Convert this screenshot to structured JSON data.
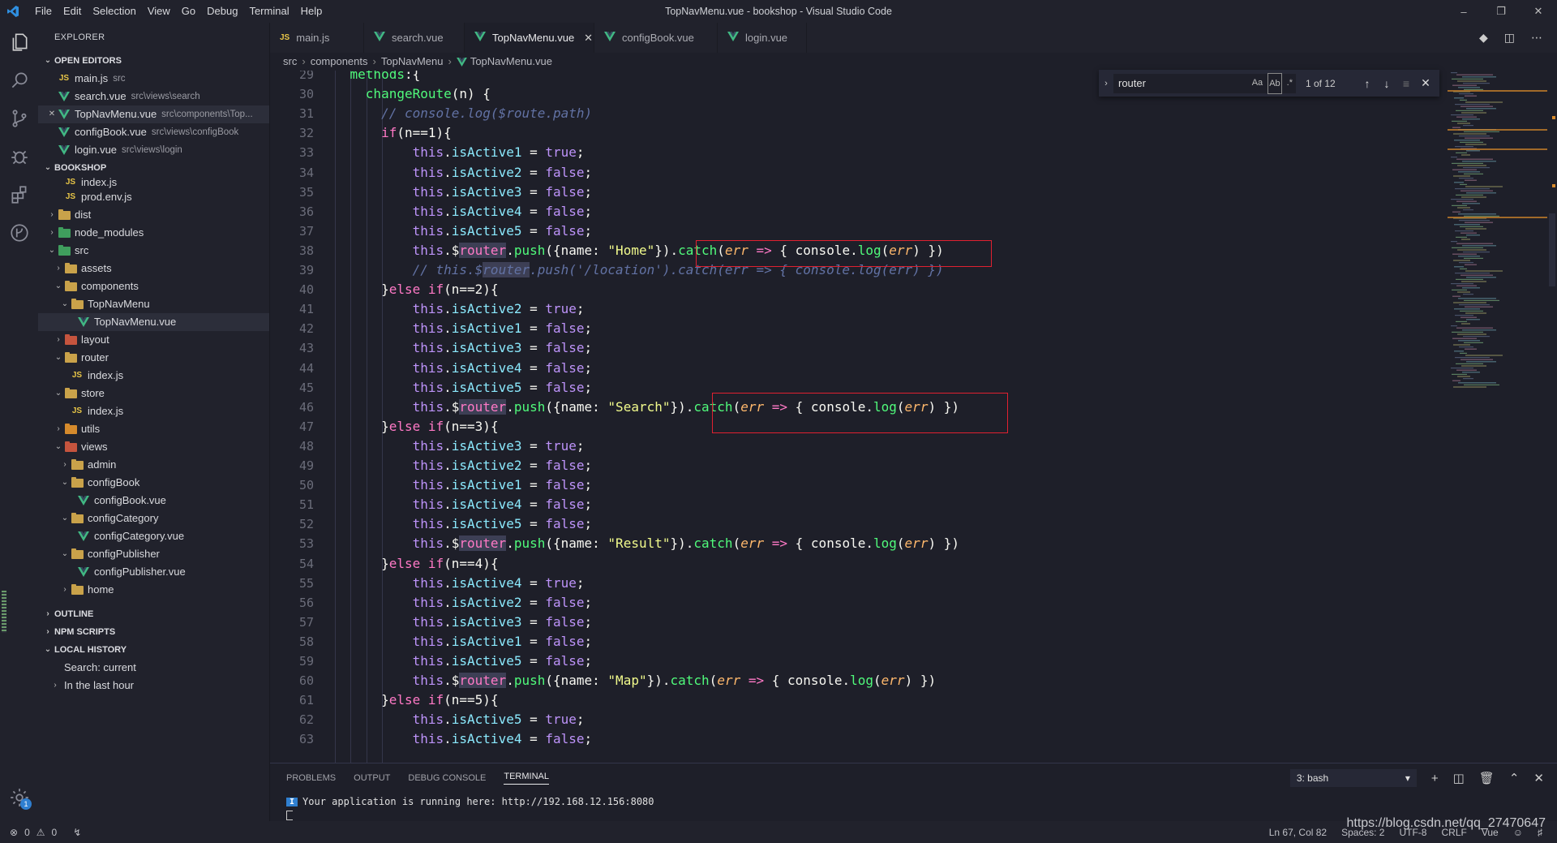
{
  "window": {
    "title": "TopNavMenu.vue - bookshop - Visual Studio Code",
    "menu": [
      "File",
      "Edit",
      "Selection",
      "View",
      "Go",
      "Debug",
      "Terminal",
      "Help"
    ]
  },
  "sidebar": {
    "title": "EXPLORER",
    "open_editors_label": "OPEN EDITORS",
    "open_editors": [
      {
        "name": "main.js",
        "desc": "src",
        "icon": "js-icon"
      },
      {
        "name": "search.vue",
        "desc": "src\\views\\search",
        "icon": "vue-icon"
      },
      {
        "name": "TopNavMenu.vue",
        "desc": "src\\components\\Top...",
        "icon": "vue-icon"
      },
      {
        "name": "configBook.vue",
        "desc": "src\\views\\configBook",
        "icon": "vue-icon"
      },
      {
        "name": "login.vue",
        "desc": "src\\views\\login",
        "icon": "vue-icon"
      }
    ],
    "project_label": "BOOKSHOP",
    "tree": [
      {
        "name": "index.js",
        "indent": 2,
        "type": "js"
      },
      {
        "name": "prod.env.js",
        "indent": 2,
        "type": "js"
      },
      {
        "name": "dist",
        "indent": 1,
        "type": "folder",
        "color": "yellow",
        "open": false
      },
      {
        "name": "node_modules",
        "indent": 1,
        "type": "folder",
        "color": "green",
        "open": false
      },
      {
        "name": "src",
        "indent": 1,
        "type": "folder",
        "color": "green",
        "open": true
      },
      {
        "name": "assets",
        "indent": 2,
        "type": "folder",
        "color": "yellow",
        "open": false
      },
      {
        "name": "components",
        "indent": 2,
        "type": "folder",
        "color": "yellow",
        "open": true
      },
      {
        "name": "TopNavMenu",
        "indent": 3,
        "type": "folder",
        "color": "yellow",
        "open": true
      },
      {
        "name": "TopNavMenu.vue",
        "indent": 4,
        "type": "vue",
        "selected": true
      },
      {
        "name": "layout",
        "indent": 2,
        "type": "folder",
        "color": "red",
        "open": false
      },
      {
        "name": "router",
        "indent": 2,
        "type": "folder",
        "color": "yellow",
        "open": true
      },
      {
        "name": "index.js",
        "indent": 3,
        "type": "js"
      },
      {
        "name": "store",
        "indent": 2,
        "type": "folder",
        "color": "yellow",
        "open": true
      },
      {
        "name": "index.js",
        "indent": 3,
        "type": "js"
      },
      {
        "name": "utils",
        "indent": 2,
        "type": "folder",
        "color": "orange",
        "open": false
      },
      {
        "name": "views",
        "indent": 2,
        "type": "folder",
        "color": "red",
        "open": true
      },
      {
        "name": "admin",
        "indent": 3,
        "type": "folder",
        "color": "yellow",
        "open": false
      },
      {
        "name": "configBook",
        "indent": 3,
        "type": "folder",
        "color": "yellow",
        "open": true
      },
      {
        "name": "configBook.vue",
        "indent": 4,
        "type": "vue"
      },
      {
        "name": "configCategory",
        "indent": 3,
        "type": "folder",
        "color": "yellow",
        "open": true
      },
      {
        "name": "configCategory.vue",
        "indent": 4,
        "type": "vue"
      },
      {
        "name": "configPublisher",
        "indent": 3,
        "type": "folder",
        "color": "yellow",
        "open": true
      },
      {
        "name": "configPublisher.vue",
        "indent": 4,
        "type": "vue"
      },
      {
        "name": "home",
        "indent": 3,
        "type": "folder",
        "color": "yellow",
        "open": false
      }
    ],
    "outline_label": "OUTLINE",
    "npm_label": "NPM SCRIPTS",
    "history_label": "LOCAL HISTORY",
    "history_items": [
      "Search: current",
      "In the last hour"
    ]
  },
  "tabs": [
    {
      "label": "main.js",
      "icon": "js-icon",
      "active": false
    },
    {
      "label": "search.vue",
      "icon": "vue-icon",
      "active": false
    },
    {
      "label": "TopNavMenu.vue",
      "icon": "vue-icon",
      "active": true
    },
    {
      "label": "configBook.vue",
      "icon": "vue-icon",
      "active": false
    },
    {
      "label": "login.vue",
      "icon": "vue-icon",
      "active": false
    }
  ],
  "breadcrumb": [
    "src",
    "components",
    "TopNavMenu",
    "TopNavMenu.vue"
  ],
  "find": {
    "value": "router",
    "count": "1 of 12"
  },
  "editor": {
    "lines": [
      {
        "n": "29",
        "t": "    methods:{"
      },
      {
        "n": "30",
        "t": "      changeRoute(n) {"
      },
      {
        "n": "31",
        "t": "        // console.log($route.path)"
      },
      {
        "n": "32",
        "t": "        if(n==1){"
      },
      {
        "n": "33",
        "t": "            this.isActive1 = true;"
      },
      {
        "n": "34",
        "t": "            this.isActive2 = false;"
      },
      {
        "n": "35",
        "t": "            this.isActive3 = false;"
      },
      {
        "n": "36",
        "t": "            this.isActive4 = false;"
      },
      {
        "n": "37",
        "t": "            this.isActive5 = false;"
      },
      {
        "n": "38",
        "t": "            this.$router.push({name: \"Home\"}).catch(err => { console.log(err) })"
      },
      {
        "n": "39",
        "t": "            // this.$router.push('/location').catch(err => { console.log(err) })"
      },
      {
        "n": "40",
        "t": "        }else if(n==2){"
      },
      {
        "n": "41",
        "t": "            this.isActive2 = true;"
      },
      {
        "n": "42",
        "t": "            this.isActive1 = false;"
      },
      {
        "n": "43",
        "t": "            this.isActive3 = false;"
      },
      {
        "n": "44",
        "t": "            this.isActive4 = false;"
      },
      {
        "n": "45",
        "t": "            this.isActive5 = false;"
      },
      {
        "n": "46",
        "t": "            this.$router.push({name: \"Search\"}).catch(err => { console.log(err) })"
      },
      {
        "n": "47",
        "t": "        }else if(n==3){"
      },
      {
        "n": "48",
        "t": "            this.isActive3 = true;"
      },
      {
        "n": "49",
        "t": "            this.isActive2 = false;"
      },
      {
        "n": "50",
        "t": "            this.isActive1 = false;"
      },
      {
        "n": "51",
        "t": "            this.isActive4 = false;"
      },
      {
        "n": "52",
        "t": "            this.isActive5 = false;"
      },
      {
        "n": "53",
        "t": "            this.$router.push({name: \"Result\"}).catch(err => { console.log(err) })"
      },
      {
        "n": "54",
        "t": "        }else if(n==4){"
      },
      {
        "n": "55",
        "t": "            this.isActive4 = true;"
      },
      {
        "n": "56",
        "t": "            this.isActive2 = false;"
      },
      {
        "n": "57",
        "t": "            this.isActive3 = false;"
      },
      {
        "n": "58",
        "t": "            this.isActive1 = false;"
      },
      {
        "n": "59",
        "t": "            this.isActive5 = false;"
      },
      {
        "n": "60",
        "t": "            this.$router.push({name: \"Map\"}).catch(err => { console.log(err) })"
      },
      {
        "n": "61",
        "t": "        }else if(n==5){"
      },
      {
        "n": "62",
        "t": "            this.isActive5 = true;"
      },
      {
        "n": "63",
        "t": "            this.isActive4 = false;"
      }
    ]
  },
  "panel": {
    "tabs": [
      "PROBLEMS",
      "OUTPUT",
      "DEBUG CONSOLE",
      "TERMINAL"
    ],
    "active_tab": "TERMINAL",
    "terminal_select": "3: bash",
    "terminal_tag": "I",
    "terminal_output": "Your application is running here: http://192.168.12.156:8080"
  },
  "status": {
    "errors": "0",
    "warnings": "0",
    "position": "Ln 67, Col 82",
    "spaces": "Spaces: 2",
    "encoding": "UTF-8",
    "eol": "CRLF",
    "language": "Vue"
  },
  "watermark": "https://blog.csdn.net/qq_27470647",
  "colors": {
    "accent": "#2f7fd0",
    "highlight_box": "#e02030",
    "background": "#1e1f29"
  }
}
